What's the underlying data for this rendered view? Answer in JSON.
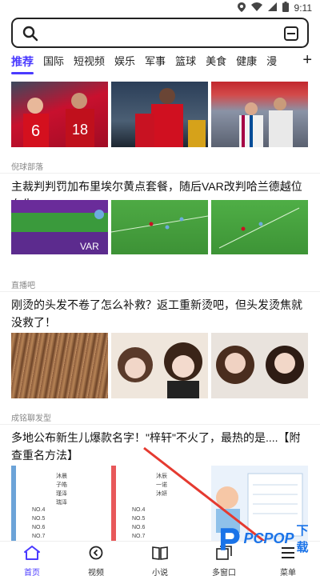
{
  "status_bar": {
    "time": "9:11"
  },
  "search": {
    "placeholder": ""
  },
  "tabs": [
    "推荐",
    "国际",
    "短视频",
    "娱乐",
    "军事",
    "篮球",
    "美食",
    "健康",
    "漫"
  ],
  "feed": {
    "items": [
      {
        "source": "倪球部落",
        "headline": ""
      },
      {
        "source": "直播吧",
        "headline": "主裁判判罚加布里埃尔黄点套餐，随后VAR改判哈兰德越位在先"
      },
      {
        "source": "成铭聊发型",
        "headline": "刚烫的头发不卷了怎么补救？返工重新烫吧，但头发烫焦就没救了！"
      },
      {
        "source": "",
        "headline": "多地公布新生儿爆款名字！\"梓轩\"不火了，最热的是....【附查重名方法】"
      }
    ]
  },
  "name_sheet": {
    "left": [
      "沐晨",
      "子皓",
      "瑾泽",
      "瑞泽",
      "NO.4",
      "NO.5",
      "NO.6",
      "NO.7"
    ],
    "right": [
      "沐辰",
      "一诺",
      "沐妍",
      "NO.4",
      "NO.5",
      "NO.6",
      "NO.7"
    ]
  },
  "bottom_nav": [
    {
      "label": "首页",
      "icon": "home-icon"
    },
    {
      "label": "视频",
      "icon": "play-circle-icon"
    },
    {
      "label": "小说",
      "icon": "book-icon"
    },
    {
      "label": "多窗口",
      "icon": "window-icon"
    },
    {
      "label": "菜单",
      "icon": "menu-icon"
    }
  ],
  "watermark": {
    "brand": "PCPOP",
    "suffix": "下载"
  },
  "colors": {
    "accent": "#4a3aff",
    "watermark": "#1a73e8"
  }
}
